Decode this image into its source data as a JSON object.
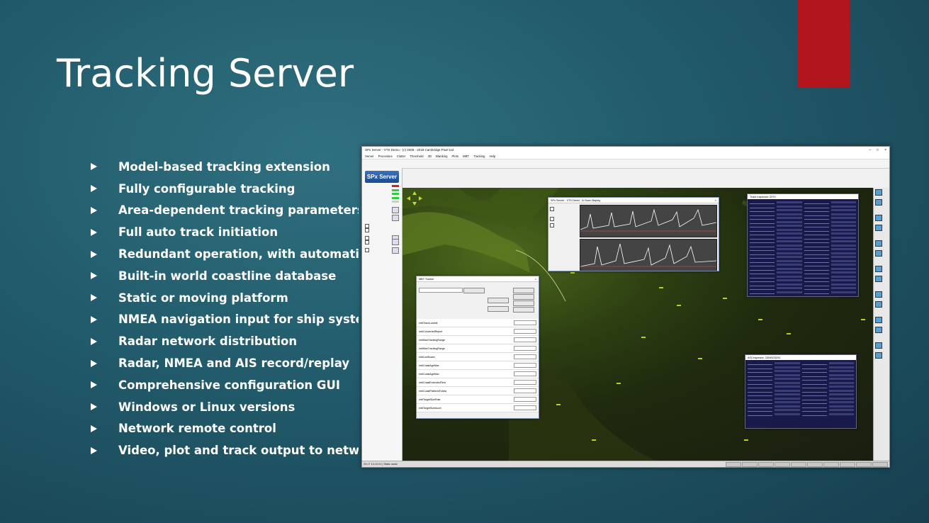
{
  "slide": {
    "title": "Tracking Server",
    "bullets": [
      "Model-based tracking extension",
      "Fully configurable tracking",
      "Area-dependent tracking parameters",
      "Full auto track initiation",
      "Redundant operation, with automatic failover",
      "Built-in world coastline database",
      "Static or moving platform",
      "NMEA navigation input for ship systems",
      "Radar network distribution",
      "Radar, NMEA and AIS record/replay",
      "Comprehensive configuration GUI",
      "Windows or Linux versions",
      "Network remote control",
      "Video, plot and track output to network"
    ]
  },
  "app": {
    "title": "SPx Server - VTS Demo - (c) 2008 - 2018 Cambridge Pixel Ltd.",
    "menu": [
      "Server",
      "Processes",
      "Clutter",
      "Threshold",
      "3D",
      "Blanking",
      "Plots",
      "MBT",
      "Tracking",
      "Help"
    ],
    "logo": "SPx Server",
    "status_text": "23:17 14:12:01 | Static radar",
    "ascan_title": "SPx Server - VTS Demo - A-Scan Display",
    "inspector_title": "Track Inspector: 2070",
    "ais_title": "AIS Inspector: 2304523203",
    "config_title": "MBT Tracker",
    "config_params": [
      "mbtTrackLostInit",
      "mbtConvertedReport",
      "mbtMaxTrackingRange",
      "mbtMaxTrackingRange",
      "mbtLostScans",
      "mbtCoastAgeMax",
      "mbtCoastAgeMax",
      "mbtCoastExtendedTime",
      "mbtCoastPlatformFollow",
      "mbtTargetSizeRate",
      "mbtTargetSizeAccel"
    ]
  }
}
